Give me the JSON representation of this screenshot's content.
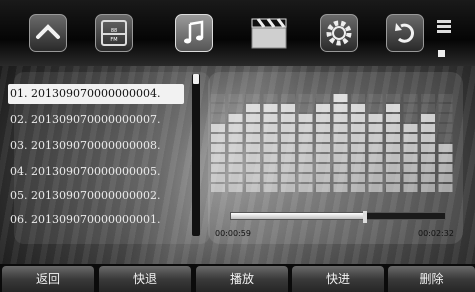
{
  "toolbar": {
    "icons": [
      "home-icon",
      "radio-fm-icon",
      "music-note-icon",
      "clapperboard-icon",
      "settings-gear-icon",
      "back-arrow-icon"
    ],
    "radio": {
      "top_text": "88",
      "bottom_text": "FM"
    }
  },
  "file_list": {
    "items": [
      "01. 201309070000000004.",
      "02. 201309070000000007.",
      "03. 201309070000000008.",
      "04. 201309070000000005.",
      "05. 201309070000000002.",
      "06. 201309070000000001."
    ],
    "selected_index": 0
  },
  "spectrum": {
    "bands": [
      7,
      8,
      9,
      9,
      9,
      8,
      9,
      10,
      9,
      8,
      9,
      7,
      8,
      5
    ]
  },
  "player": {
    "elapsed": "00:00:59",
    "total": "00:02:32",
    "progress": 0.62
  },
  "controls": {
    "return_label": "返回",
    "rewind_label": "快退",
    "play_label": "播放",
    "forward_label": "快进",
    "delete_label": "删除"
  }
}
